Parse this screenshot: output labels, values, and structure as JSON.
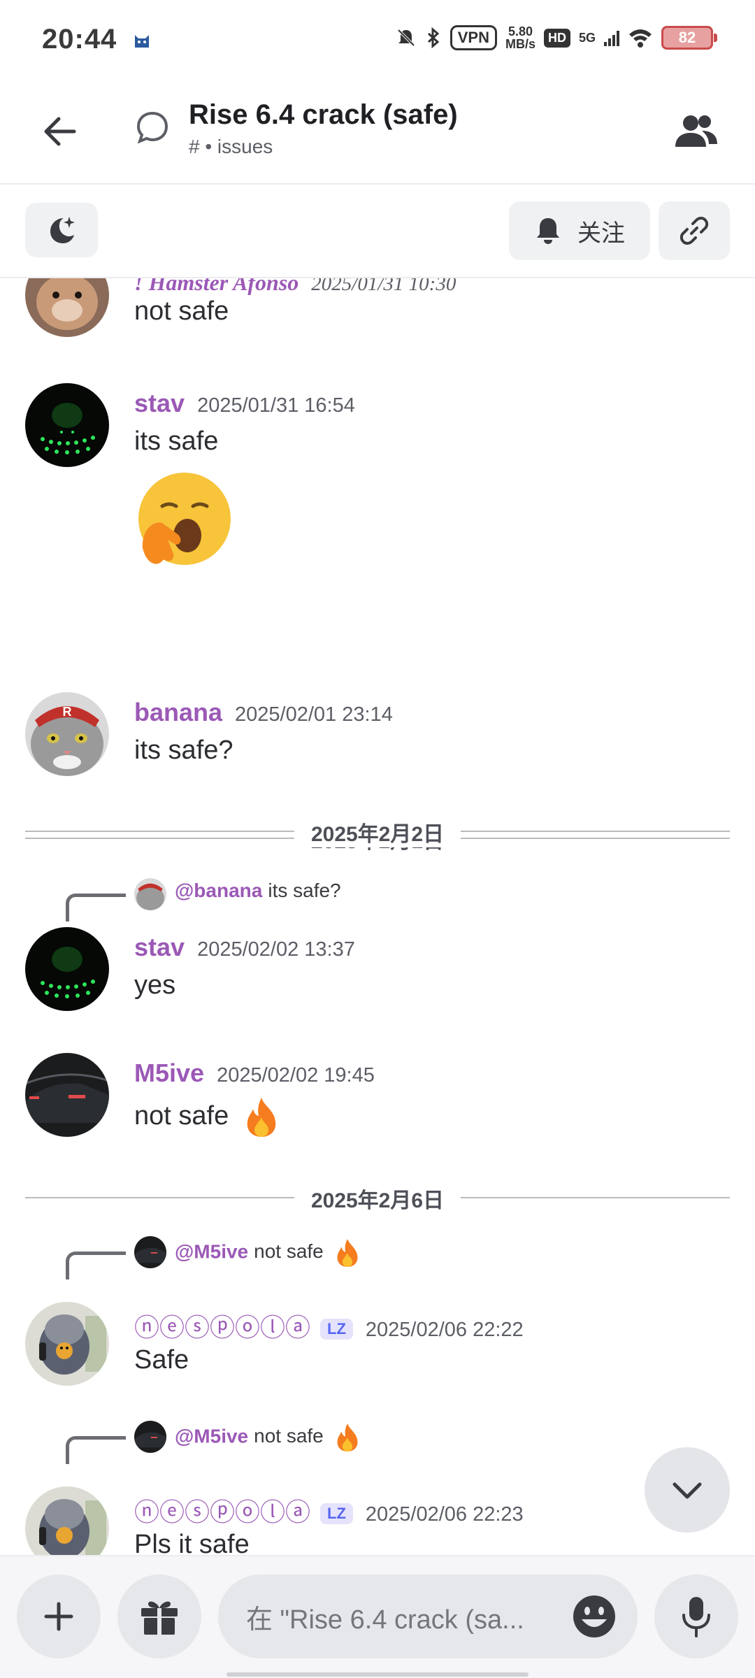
{
  "status_bar": {
    "time": "20:44",
    "vpn": "VPN",
    "speed_value": "5.80",
    "speed_unit": "MB/s",
    "hd": "HD",
    "network": "5G",
    "battery": "82"
  },
  "header": {
    "title": "Rise 6.4 crack (safe)",
    "subtitle": "# • issues"
  },
  "actions": {
    "follow_label": "关注"
  },
  "messages": [
    {
      "name": "! Hamster Afonso",
      "time": "2025/01/31 10:30",
      "text": "not safe"
    },
    {
      "name": "stav",
      "time": "2025/01/31 16:54",
      "text": "its safe"
    },
    {
      "name": "banana",
      "time": "2025/02/01 23:14",
      "text": "its safe?"
    },
    {
      "name": "stav",
      "time": "2025/02/02 13:37",
      "text": "yes",
      "reply_name": "@banana",
      "reply_text": "its safe?"
    },
    {
      "name": "M5ive",
      "time": "2025/02/02 19:45",
      "text": "not safe"
    },
    {
      "name": "ⓝⓔⓢⓟⓞⓛⓐ",
      "badge": "LZ",
      "time": "2025/02/06 22:22",
      "text": "Safe",
      "reply_name": "@M5ive",
      "reply_text": "not safe"
    },
    {
      "name": "ⓝⓔⓢⓟⓞⓛⓐ",
      "badge": "LZ",
      "time": "2025/02/06 22:23",
      "text": "Pls it safe",
      "reply_name": "@M5ive",
      "reply_text": "not safe"
    }
  ],
  "dividers": [
    "2025年2月1日",
    "2025年2月2日",
    "2025年2月6日"
  ],
  "composer": {
    "placeholder": "在 \"Rise 6.4 crack (sa..."
  },
  "icons": {
    "back": "arrow-left-icon",
    "thread": "thread-bubble-icon",
    "members": "members-icon",
    "moon": "moon-icon",
    "bell": "bell-icon",
    "link": "link-icon",
    "plus": "plus-icon",
    "gift": "gift-icon",
    "emoji": "emoji-icon",
    "mic": "mic-icon",
    "chevron": "chevron-down-icon"
  }
}
